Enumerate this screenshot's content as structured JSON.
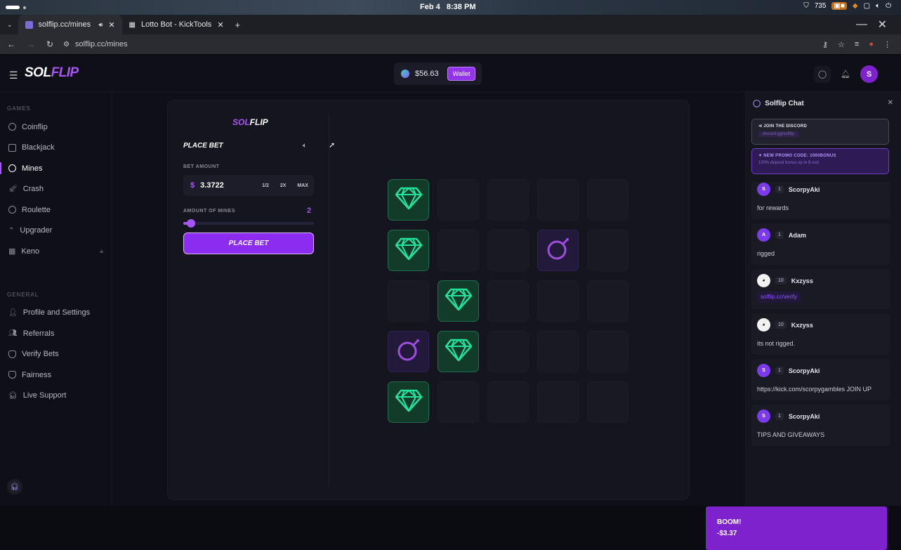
{
  "os": {
    "date": "Feb 4",
    "time": "8:38 PM",
    "battery": "735"
  },
  "browser": {
    "tabs": [
      {
        "title": "solflip.cc/mines"
      },
      {
        "title": "Lotto Bot - KickTools"
      }
    ],
    "url": "solflip.cc/mines"
  },
  "header": {
    "logo_sol": "SOL",
    "logo_flip": "FLIP",
    "balance": "$56.63",
    "wallet_label": "Wallet",
    "avatar_initial": "S"
  },
  "sidebar": {
    "games_heading": "GAMES",
    "games": [
      {
        "label": "Coinflip",
        "icon": "coin-icon"
      },
      {
        "label": "Blackjack",
        "icon": "cards-icon"
      },
      {
        "label": "Mines",
        "icon": "bomb-icon",
        "active": true
      },
      {
        "label": "Crash",
        "icon": "rocket-icon"
      },
      {
        "label": "Roulette",
        "icon": "roulette-icon"
      },
      {
        "label": "Upgrader",
        "icon": "chevron-up-icon"
      },
      {
        "label": "Keno",
        "icon": "grid-icon",
        "locked": true
      }
    ],
    "general_heading": "GENERAL",
    "general": [
      {
        "label": "Profile and Settings",
        "icon": "user-icon"
      },
      {
        "label": "Referrals",
        "icon": "users-icon"
      },
      {
        "label": "Verify Bets",
        "icon": "shield-icon"
      },
      {
        "label": "Fairness",
        "icon": "shield-check-icon"
      },
      {
        "label": "Live Support",
        "icon": "headset-icon"
      }
    ]
  },
  "game": {
    "logo_sol": "SOL",
    "logo_flip": "FLIP",
    "title": "PLACE BET",
    "bet_amount_label": "BET AMOUNT",
    "currency": "$",
    "bet_amount": "3.3722",
    "half_label": "1/2",
    "double_label": "2X",
    "max_label": "MAX",
    "mines_label": "AMOUNT OF MINES",
    "mines_count": "2",
    "mines_fraction": 0.04,
    "place_bet_label": "PLACE BET",
    "grid": [
      [
        "gem",
        "",
        "",
        "",
        ""
      ],
      [
        "gem",
        "",
        "",
        "bomb",
        ""
      ],
      [
        "",
        "gem",
        "",
        "",
        ""
      ],
      [
        "bomb",
        "gem",
        "",
        "",
        ""
      ],
      [
        "gem",
        "",
        "",
        "",
        ""
      ]
    ]
  },
  "chat": {
    "title": "Solflip Chat",
    "discord_title": "JOIN THE DISCORD",
    "discord_link": "discord.gg/solflip",
    "promo_title": "NEW PROMO CODE: 1000BONUS",
    "promo_sub": "100% deposit bonus up to $ usd",
    "messages": [
      {
        "initial": "S",
        "level": "1",
        "name": "ScorpyAki",
        "text": "for rewards"
      },
      {
        "initial": "A",
        "level": "1",
        "name": "Adam",
        "text": "rigged"
      },
      {
        "initial": "",
        "level": "10",
        "name": "Kxzyss",
        "text": "solflip.cc/verify",
        "link": true
      },
      {
        "initial": "",
        "level": "10",
        "name": "Kxzyss",
        "text": "its not rigged."
      },
      {
        "initial": "S",
        "level": "1",
        "name": "ScorpyAki",
        "text": "https://kick.com/scorpygambles JOIN UP"
      },
      {
        "initial": "S",
        "level": "1",
        "name": "ScorpyAki",
        "text": "TIPS AND GIVEAWAYS"
      }
    ]
  },
  "toast": {
    "title": "BOOM!",
    "amount": "-$3.37"
  },
  "colors": {
    "accent": "#a855f7",
    "gem": "#22e39a",
    "bg": "#0f0f17"
  }
}
